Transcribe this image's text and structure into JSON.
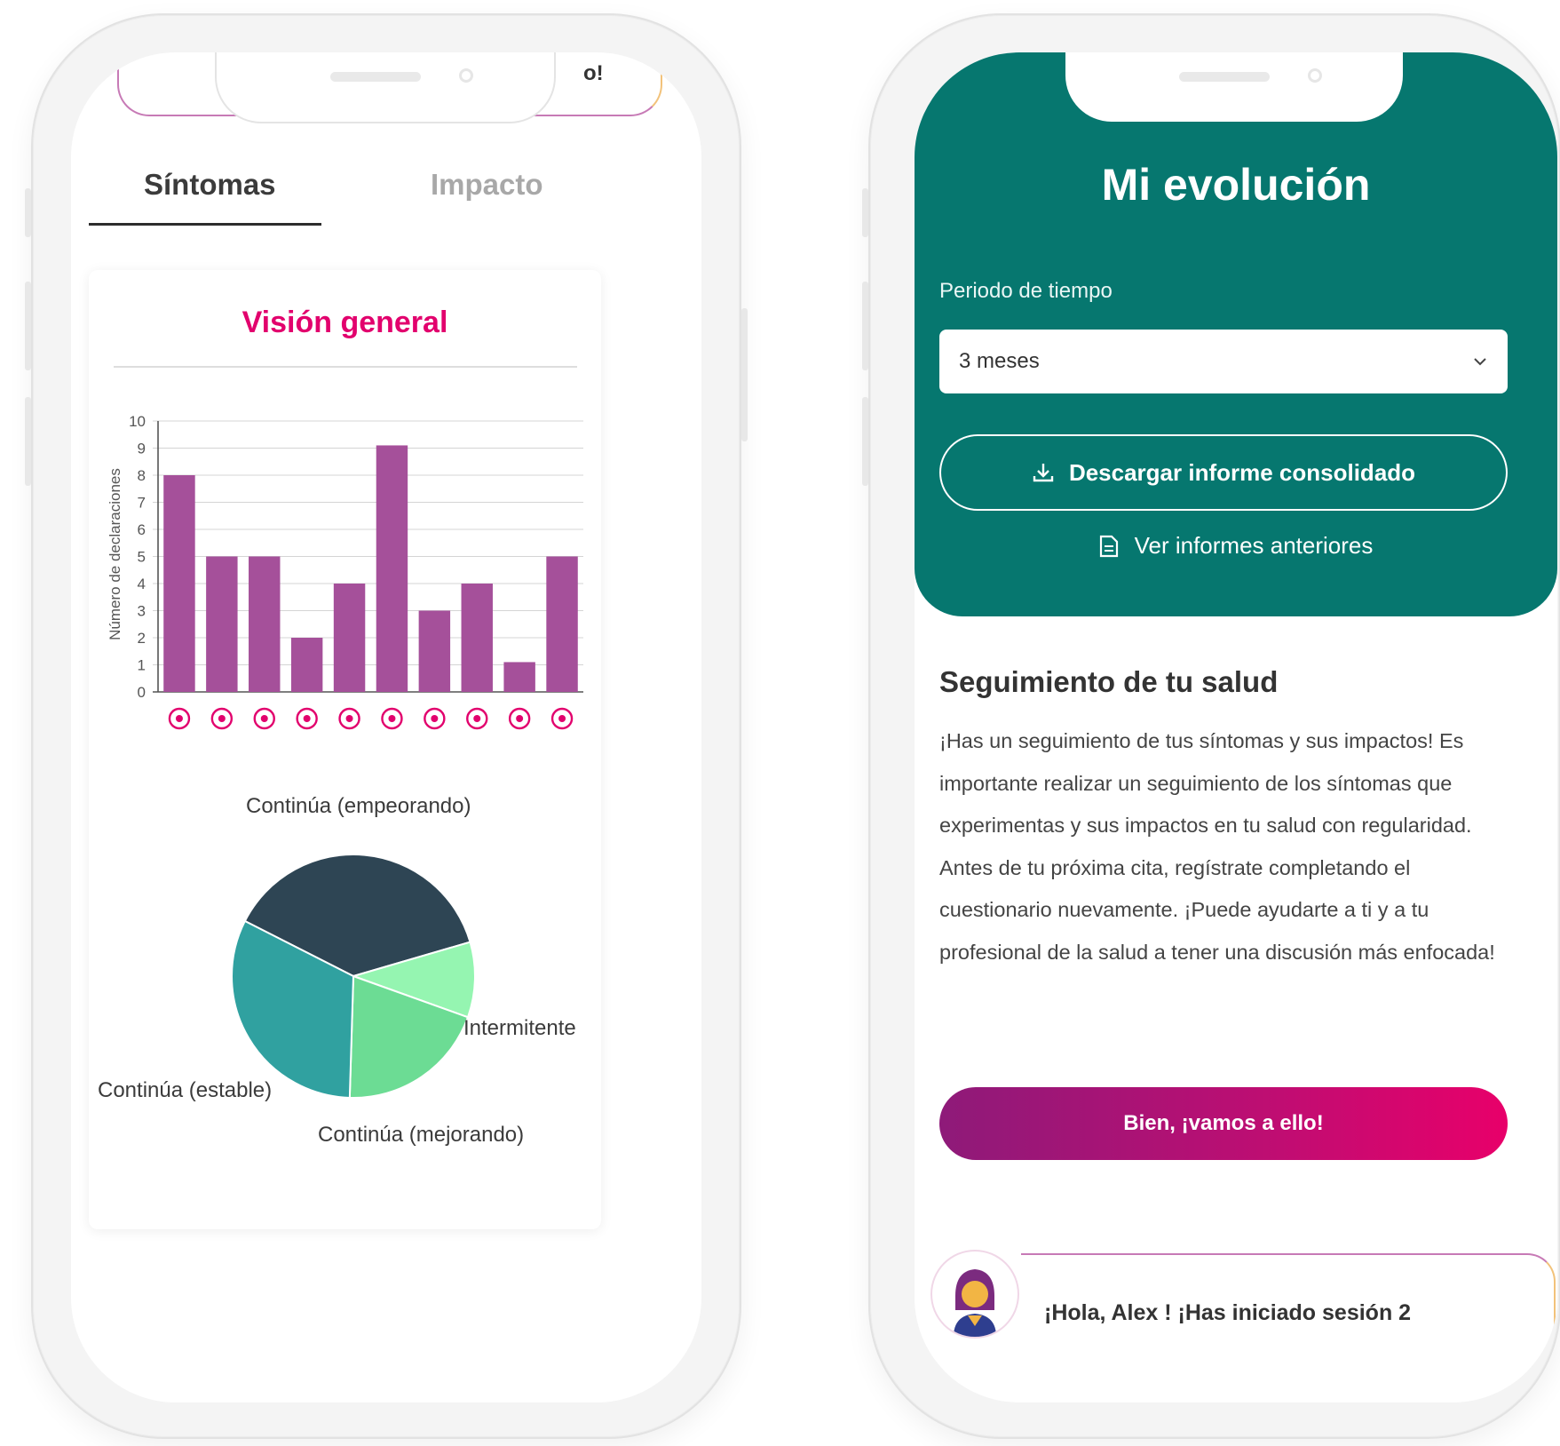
{
  "left_phone": {
    "top_card_fragment": "o!",
    "tabs": [
      {
        "label": "Síntomas",
        "active": true
      },
      {
        "label": "Impacto",
        "active": false
      }
    ],
    "chart_title": "Visión general",
    "icons": [
      "walking-person-icon",
      "head-pain-icon",
      "brain-icon",
      "eye-icon",
      "speech-bubble-icon",
      "balance-person-icon",
      "body-posture-icon",
      "tingling-icon",
      "falling-person-icon",
      "sparkles-icon"
    ]
  },
  "chart_data": [
    {
      "type": "bar",
      "ylabel": "Número de declaraciones",
      "ylim": [
        0,
        10
      ],
      "yticks": [
        0,
        1,
        2,
        3,
        4,
        5,
        6,
        7,
        8,
        9,
        10
      ],
      "categories": [
        "walking",
        "head-pain",
        "brain",
        "eye",
        "speech",
        "balance",
        "body-posture",
        "tingling",
        "falling",
        "sparkles"
      ],
      "values": [
        8,
        5,
        5,
        2,
        4,
        9.1,
        3,
        4,
        1.1,
        5
      ],
      "bar_color": "#a5509a",
      "grid": true
    },
    {
      "type": "pie",
      "slices": [
        {
          "label": "Continúa (empeorando)",
          "value": 38,
          "color": "#2e4554"
        },
        {
          "label": "Intermitente",
          "value": 10,
          "color": "#95f5b1"
        },
        {
          "label": "Continúa (mejorando)",
          "value": 20,
          "color": "#6cdc94"
        },
        {
          "label": "Continúa (estable)",
          "value": 32,
          "color": "#30a1a0"
        }
      ]
    }
  ],
  "right_phone": {
    "title": "Mi evolución",
    "period_label": "Periodo de tiempo",
    "period_value": "3 meses",
    "download_label": "Descargar informe consolidado",
    "prev_reports_label": "Ver informes anteriores",
    "section_title": "Seguimiento de tu salud",
    "section_body": "¡Has un seguimiento de tus síntomas y sus impactos! Es importante realizar un seguimiento de los síntomas que experimentas y sus impactos en tu salud con regularidad. Antes de tu próxima cita, regístrate completando el cuestionario nuevamente. ¡Puede ayudarte a ti y a tu profesional de la salud a tener una discusión más enfocada!",
    "cta_label": "Bien, ¡vamos a ello!",
    "greeting": "¡Hola, Alex ! ¡Has iniciado sesión 2"
  },
  "colors": {
    "accent_pink": "#e2006d",
    "teal_header": "#06776f",
    "bar_purple": "#a5509a"
  }
}
